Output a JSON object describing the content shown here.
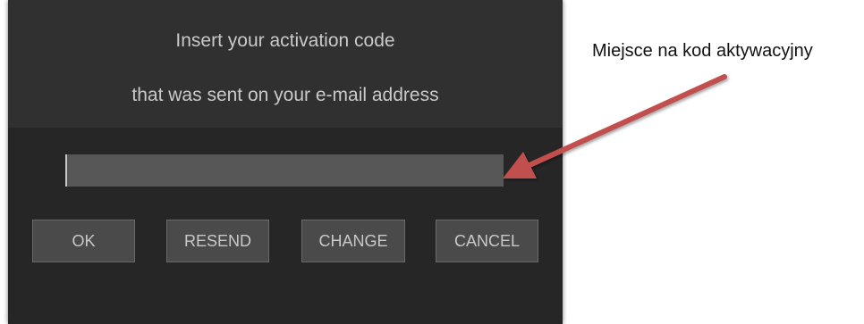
{
  "dialog": {
    "message_line_1": "Insert your activation code",
    "message_line_2": "that was sent on your e-mail address",
    "activation_code_value": "",
    "buttons": {
      "ok": "OK",
      "resend": "RESEND",
      "change": "CHANGE",
      "cancel": "CANCEL"
    }
  },
  "annotation": {
    "text": "Miejsce na kod aktywacyjny",
    "arrow_icon": "arrow-icon",
    "arrow_color": "#c0504d"
  },
  "colors": {
    "dialog_background": "#262626",
    "header_background": "#303031",
    "input_background": "#575757",
    "button_background": "#4a4a4a",
    "text_light": "#c9c9c9"
  }
}
